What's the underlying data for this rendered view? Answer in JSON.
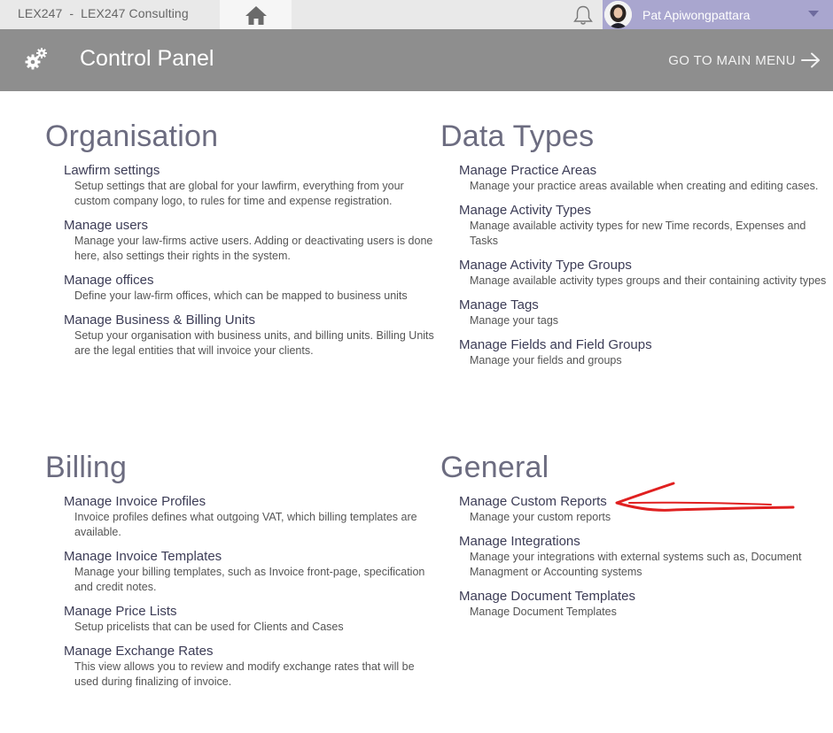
{
  "topbar": {
    "app_title": "LEX247  -  LEX247 Consulting",
    "user_name": "Pat Apiwongpattara"
  },
  "icons": [
    "home-icon",
    "bell-icon",
    "avatar",
    "chevron-down-icon",
    "gears-icon",
    "arrow-right-icon"
  ],
  "header": {
    "title": "Control Panel",
    "goto_label": "GO TO MAIN MENU"
  },
  "sections": {
    "organisation": {
      "title": "Organisation",
      "items": [
        {
          "label": "Lawfirm settings",
          "desc": "Setup settings that are global for your lawfirm, everything from your custom company logo, to rules for time and expense registration."
        },
        {
          "label": "Manage users",
          "desc": "Manage your law-firms active users. Adding or deactivating users is done here, also settings their rights in the system."
        },
        {
          "label": "Manage offices",
          "desc": "Define your law-firm offices, which can be mapped to business units"
        },
        {
          "label": "Manage Business & Billing Units",
          "desc": "Setup your organisation with business units, and billing units. Billing Units are the legal entities that will invoice your clients."
        }
      ]
    },
    "data_types": {
      "title": "Data Types",
      "items": [
        {
          "label": "Manage Practice Areas",
          "desc": "Manage your practice areas available when creating and editing cases."
        },
        {
          "label": "Manage Activity Types",
          "desc": "Manage available activity types for new Time records, Expenses and Tasks"
        },
        {
          "label": "Manage Activity Type Groups",
          "desc": "Manage available activity types groups and their containing activity types"
        },
        {
          "label": "Manage Tags",
          "desc": "Manage your tags"
        },
        {
          "label": "Manage Fields and Field Groups",
          "desc": "Manage your fields and groups"
        }
      ]
    },
    "billing": {
      "title": "Billing",
      "items": [
        {
          "label": "Manage Invoice Profiles",
          "desc": "Invoice profiles defines what outgoing VAT, which billing templates are available."
        },
        {
          "label": "Manage Invoice Templates",
          "desc": "Manage your billing templates, such as Invoice front-page, specification and credit notes."
        },
        {
          "label": "Manage Price Lists",
          "desc": "Setup pricelists that can be used for Clients and Cases"
        },
        {
          "label": "Manage Exchange Rates",
          "desc": "This view allows you to review and modify exchange rates that will be used during finalizing of invoice."
        }
      ]
    },
    "general": {
      "title": "General",
      "items": [
        {
          "label": "Manage Custom Reports",
          "desc": "Manage your custom reports"
        },
        {
          "label": "Manage Integrations",
          "desc": "Manage your integrations with external systems such as, Document Managment or Accounting systems"
        },
        {
          "label": "Manage Document Templates",
          "desc": "Manage Document Templates"
        }
      ]
    }
  },
  "colors": {
    "header_bg": "#8e8e8e",
    "user_bg": "#a9a6cf",
    "annotation": "#e02020"
  }
}
